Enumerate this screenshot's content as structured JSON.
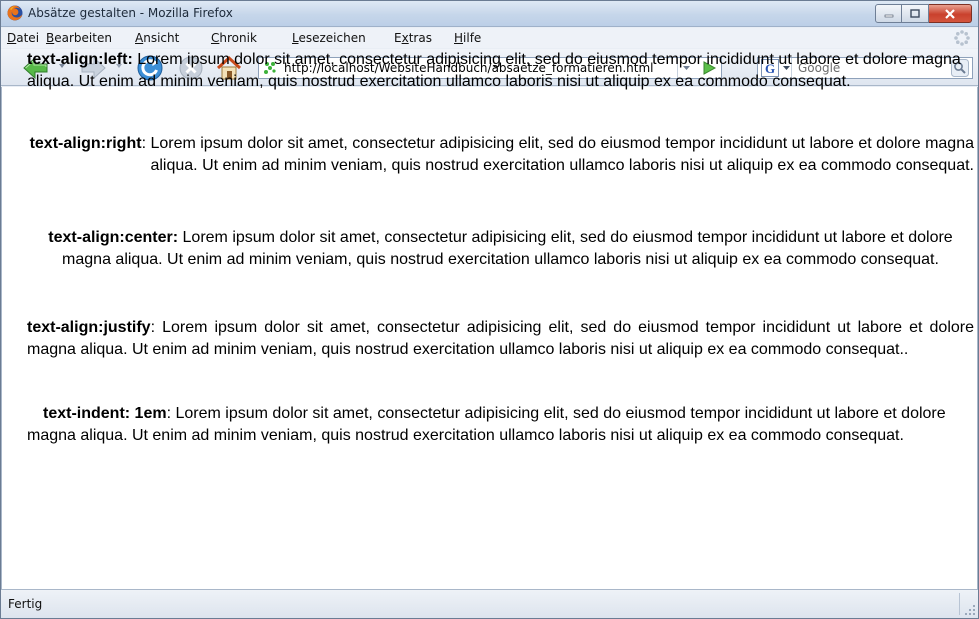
{
  "window": {
    "title": "Absätze gestalten - Mozilla Firefox"
  },
  "menu": {
    "items": [
      {
        "acc": "D",
        "rest": "atei"
      },
      {
        "acc": "B",
        "rest": "earbeiten"
      },
      {
        "acc": "A",
        "rest": "nsicht"
      },
      {
        "acc": "C",
        "rest": "hronik"
      },
      {
        "acc": "L",
        "rest": "esezeichen"
      },
      {
        "pre": "E",
        "acc": "x",
        "rest": "tras"
      },
      {
        "acc": "H",
        "rest": "ilfe"
      }
    ]
  },
  "navbar": {
    "url": "http://localhost/WebsiteHandbuch/absaetze_formatieren.html",
    "search_placeholder": "Google",
    "icons": [
      "back-icon",
      "forward-icon",
      "reload-icon",
      "stop-icon",
      "home-icon"
    ]
  },
  "content": {
    "paragraphs": [
      {
        "label": "text-align:left:",
        "text": " Lorem ipsum dolor sit amet, consectetur adipisicing elit, sed do eiusmod tempor incididunt ut labore et dolore magna aliqua. Ut enim ad minim veniam, quis nostrud exercitation ullamco laboris nisi ut aliquip ex ea commodo consequat."
      },
      {
        "label": "text-align:right",
        "text": ": Lorem ipsum dolor sit amet, consectetur adipisicing elit, sed do eiusmod tempor incididunt ut labore et dolore magna aliqua. Ut enim ad minim veniam, quis nostrud exercitation ullamco laboris nisi ut aliquip ex ea commodo consequat."
      },
      {
        "label": "text-align:center:",
        "text": " Lorem ipsum dolor sit amet, consectetur adipisicing elit, sed do eiusmod tempor incididunt ut labore et dolore magna aliqua. Ut enim ad minim veniam, quis nostrud exercitation ullamco laboris nisi ut aliquip ex ea commodo consequat."
      },
      {
        "label": "text-align:justify",
        "text": ": Lorem ipsum dolor sit amet, consectetur adipisicing elit, sed do eiusmod tempor incididunt ut labore et dolore magna aliqua. Ut enim ad minim veniam, quis nostrud exercitation ullamco laboris nisi ut aliquip ex ea commodo consequat.."
      },
      {
        "label": "text-indent: 1em",
        "text": ": Lorem ipsum dolor sit amet, consectetur adipisicing elit, sed do eiusmod tempor incididunt ut labore et dolore magna aliqua. Ut enim ad minim veniam, quis nostrud exercitation ullamco laboris nisi ut aliquip ex ea commodo consequat."
      }
    ]
  },
  "status": {
    "text": "Fertig"
  },
  "colors": {
    "titlebar": "#c6d6ea",
    "close_button": "#c9412d",
    "background": "#ffffff"
  }
}
